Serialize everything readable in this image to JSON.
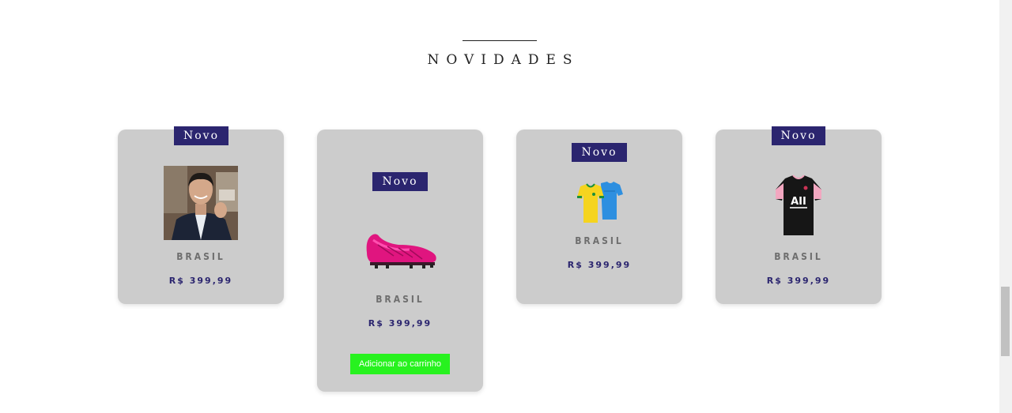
{
  "section": {
    "title": "NOVIDADES"
  },
  "products": [
    {
      "badge": "Novo",
      "name": "BRASIL",
      "price": "R$ 399,99",
      "image": "person-photo"
    },
    {
      "badge": "Novo",
      "name": "BRASIL",
      "price": "R$ 399,99",
      "image": "pink-soccer-cleat",
      "cart_button": "Adicionar ao carrinho"
    },
    {
      "badge": "Novo",
      "name": "BRASIL",
      "price": "R$ 399,99",
      "image": "brazil-jerseys"
    },
    {
      "badge": "Novo",
      "name": "BRASIL",
      "price": "R$ 399,99",
      "image": "psg-black-jersey"
    }
  ],
  "colors": {
    "card_bg": "#cccccc",
    "badge_bg": "#2b256f",
    "price": "#2b256f",
    "cart_button": "#27f21f"
  }
}
